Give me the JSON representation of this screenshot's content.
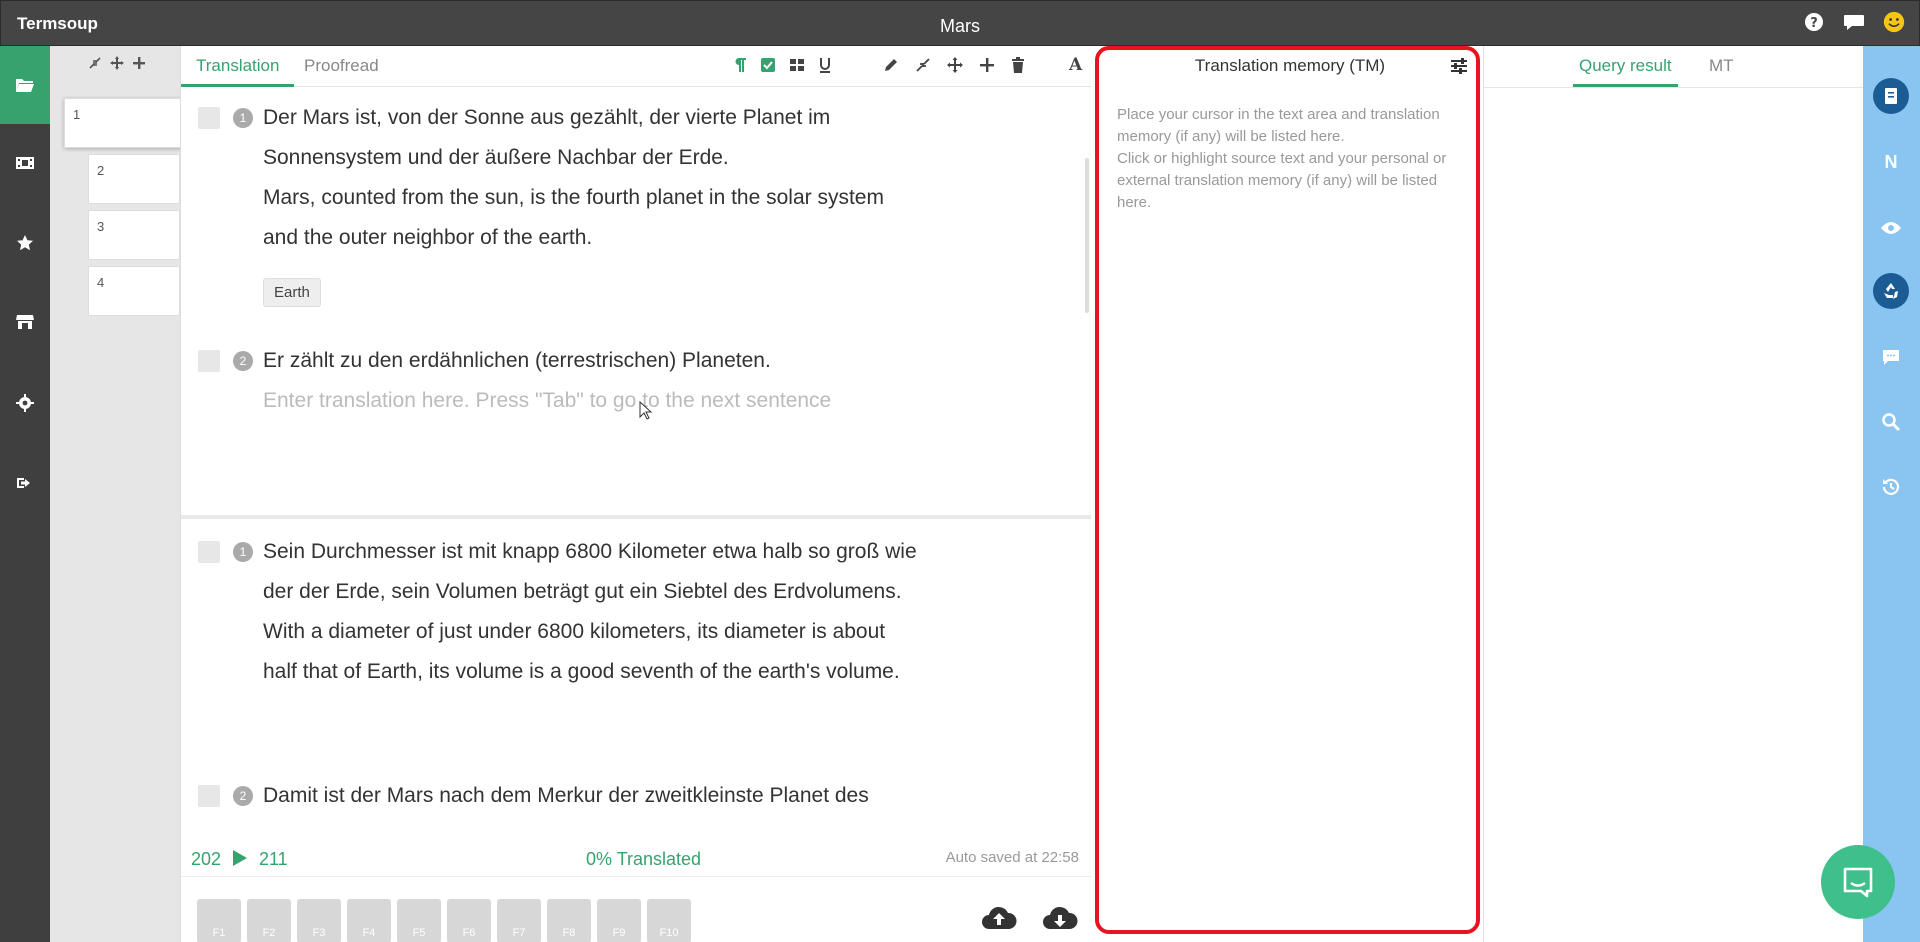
{
  "app": {
    "name": "Termsoup",
    "document_title": "Mars"
  },
  "top_icons": [
    "help-icon",
    "chat-icon",
    "smiley-icon"
  ],
  "left_rail": [
    "folder-icon",
    "film-icon",
    "star-icon",
    "store-icon",
    "gear-icon",
    "sign-out-icon"
  ],
  "pages": [
    "1",
    "2",
    "3",
    "4"
  ],
  "editor": {
    "tabs": [
      {
        "label": "Translation",
        "active": true
      },
      {
        "label": "Proofread",
        "active": false
      }
    ],
    "segments": [
      {
        "number": "1",
        "source_lines": [
          "Der Mars ist, von der Sonne aus gezählt, der vierte Planet im",
          "Sonnensystem und der äußere Nachbar der Erde."
        ],
        "target_lines": [
          "Mars, counted from the sun, is the fourth planet in the solar system",
          "and the outer neighbor of the earth."
        ],
        "term": "Earth"
      },
      {
        "number": "2",
        "source_lines": [
          "Er zählt zu den erdähnlichen (terrestrischen) Planeten."
        ],
        "placeholder": "Enter translation here. Press \"Tab\" to go to the next sentence"
      },
      {
        "number": "1",
        "source_lines": [
          "Sein Durchmesser ist mit knapp 6800 Kilometer etwa halb so groß wie",
          "der der Erde, sein Volumen beträgt gut ein Siebtel des Erdvolumens."
        ],
        "target_lines": [
          "With a diameter of just under 6800 kilometers, its diameter is about",
          "half that of Earth, its volume is a good seventh of the earth's volume."
        ]
      },
      {
        "number": "2",
        "source_lines": [
          "Damit ist der Mars nach dem Merkur der zweitkleinste Planet des"
        ]
      }
    ],
    "status": {
      "current_count": "202",
      "total_count": "211",
      "translated": "0% Translated",
      "autosave": "Auto saved at 22:58"
    },
    "function_keys": [
      "F1",
      "F2",
      "F3",
      "F4",
      "F5",
      "F6",
      "F7",
      "F8",
      "F9",
      "F10"
    ]
  },
  "tm_panel": {
    "title": "Translation memory (TM)",
    "line1": "Place your cursor in the text area and translation memory (if any) will be listed here.",
    "line2": "Click or highlight source text and your personal or external translation memory (if any) will be listed here."
  },
  "query_panel": {
    "tabs": [
      {
        "label": "Query result",
        "active": true
      },
      {
        "label": "MT",
        "active": false
      }
    ]
  },
  "right_rail": {
    "n_label": "N"
  },
  "colors": {
    "accent": "#36a36e",
    "highlight": "#e5141f",
    "rail": "#8ac5f2"
  }
}
